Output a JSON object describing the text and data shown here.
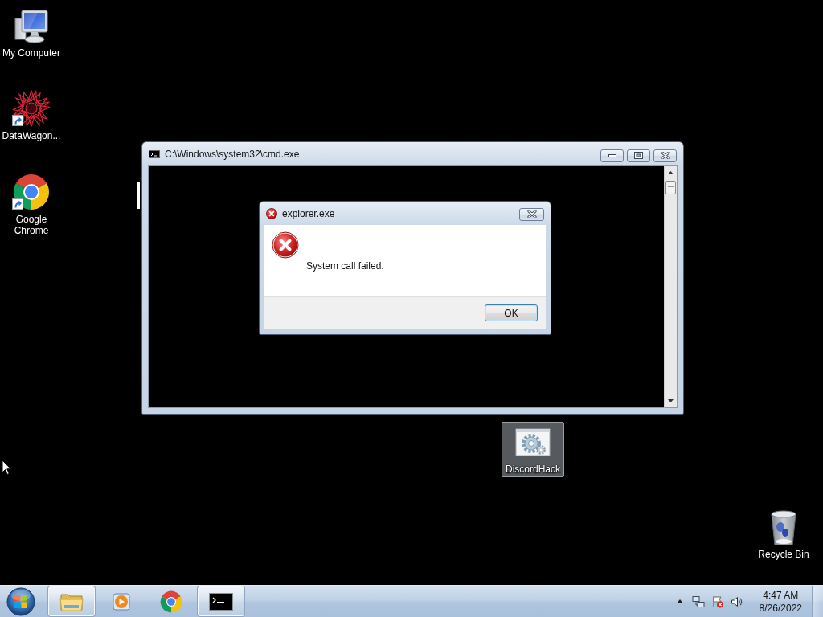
{
  "desktop_icons": [
    {
      "label": "My Computer",
      "kind": "computer",
      "shortcut": false,
      "selected": false
    },
    {
      "label": "DataWagon...",
      "kind": "datawagon",
      "shortcut": true,
      "selected": false
    },
    {
      "label": "Google Chrome",
      "kind": "chrome",
      "shortcut": true,
      "selected": false
    },
    {
      "label": "DiscordHack",
      "kind": "program",
      "shortcut": false,
      "selected": true
    },
    {
      "label": "Recycle Bin",
      "kind": "recycle",
      "shortcut": false,
      "selected": false
    }
  ],
  "console_window": {
    "title": "C:\\Windows\\system32\\cmd.exe"
  },
  "error_dialog": {
    "title": "explorer.exe",
    "message": "System call failed.",
    "buttons": [
      "OK"
    ]
  },
  "taskbar": {
    "items": [
      {
        "kind": "explorer",
        "running": true
      },
      {
        "kind": "media",
        "running": false
      },
      {
        "kind": "chrome",
        "running": false
      },
      {
        "kind": "console",
        "running": true
      }
    ],
    "clock": {
      "time": "4:47 AM",
      "date": "8/26/2022"
    }
  }
}
